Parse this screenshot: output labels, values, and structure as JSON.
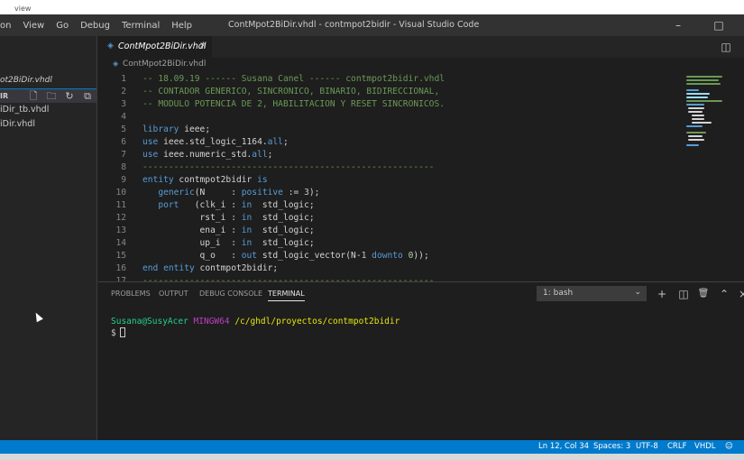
{
  "top_strip": {
    "label": "view"
  },
  "menu": [
    "on",
    "View",
    "Go",
    "Debug",
    "Terminal",
    "Help"
  ],
  "window_title": "ContMpot2BiDir.vhdl - contmpot2bidir - Visual Studio Code",
  "window_controls": {
    "minimize": "–",
    "maximize": "□"
  },
  "sidebar": {
    "project_label": "ot2BiDir.vhdl",
    "dir_label": "IR",
    "files": [
      "iDir_tb.vhdl",
      "iDir.vhdl"
    ]
  },
  "tab": {
    "label": "ContMpot2BiDir.vhdl",
    "close": "×"
  },
  "breadcrumb": {
    "label": "ContMpot2BiDir.vhdl"
  },
  "code_lines": [
    {
      "n": "1",
      "tokens": [
        [
          "cm",
          "-- 18.09.19 ------ Susana Canel ------ contmpot2bidir.vhdl"
        ]
      ]
    },
    {
      "n": "2",
      "tokens": [
        [
          "cm",
          "-- CONTADOR GENERICO, SINCRONICO, BINARIO, BIDIRECCIONAL,"
        ]
      ]
    },
    {
      "n": "3",
      "tokens": [
        [
          "cm",
          "-- MODULO POTENCIA DE 2, HABILITACION Y RESET SINCRONICOS."
        ]
      ]
    },
    {
      "n": "4",
      "tokens": []
    },
    {
      "n": "5",
      "tokens": [
        [
          "kw",
          "library"
        ],
        [
          "id",
          " ieee;"
        ]
      ]
    },
    {
      "n": "6",
      "tokens": [
        [
          "kw",
          "use"
        ],
        [
          "id",
          " ieee.std_logic_1164."
        ],
        [
          "kw",
          "all"
        ],
        [
          "id",
          ";"
        ]
      ]
    },
    {
      "n": "7",
      "tokens": [
        [
          "kw",
          "use"
        ],
        [
          "id",
          " ieee.numeric_std."
        ],
        [
          "kw",
          "all"
        ],
        [
          "id",
          ";"
        ]
      ]
    },
    {
      "n": "8",
      "tokens": [
        [
          "cm",
          "--------------------------------------------------------"
        ]
      ]
    },
    {
      "n": "9",
      "tokens": [
        [
          "kw",
          "entity"
        ],
        [
          "id",
          " contmpot2bidir "
        ],
        [
          "kw",
          "is"
        ]
      ]
    },
    {
      "n": "10",
      "tokens": [
        [
          "kw",
          "   generic"
        ],
        [
          "id",
          "(N     : "
        ],
        [
          "kw",
          "positive"
        ],
        [
          "id",
          " := "
        ],
        [
          "num",
          "3"
        ],
        [
          "id",
          ");"
        ]
      ]
    },
    {
      "n": "11",
      "tokens": [
        [
          "kw",
          "   port"
        ],
        [
          "id",
          "   (clk_i : "
        ],
        [
          "kw",
          "in"
        ],
        [
          "id",
          "  std_logic;"
        ]
      ]
    },
    {
      "n": "12",
      "tokens": [
        [
          "id",
          "           rst_i : "
        ],
        [
          "kw",
          "in"
        ],
        [
          "id",
          "  std_logic;"
        ]
      ]
    },
    {
      "n": "13",
      "tokens": [
        [
          "id",
          "           ena_i : "
        ],
        [
          "kw",
          "in"
        ],
        [
          "id",
          "  std_logic;"
        ]
      ]
    },
    {
      "n": "14",
      "tokens": [
        [
          "id",
          "           up_i  : "
        ],
        [
          "kw",
          "in"
        ],
        [
          "id",
          "  std_logic;"
        ]
      ]
    },
    {
      "n": "15",
      "tokens": [
        [
          "id",
          "           q_o   : "
        ],
        [
          "kw",
          "out"
        ],
        [
          "id",
          " std_logic_vector(N-"
        ],
        [
          "num",
          "1"
        ],
        [
          "kw",
          " downto "
        ],
        [
          "num",
          "0"
        ],
        [
          "id",
          "));"
        ]
      ]
    },
    {
      "n": "16",
      "tokens": [
        [
          "kw",
          "end entity"
        ],
        [
          "id",
          " contmpot2bidir;"
        ]
      ]
    },
    {
      "n": "17",
      "tokens": [
        [
          "cm",
          "--------------------------------------------------------"
        ]
      ]
    }
  ],
  "panel": {
    "tabs": [
      "PROBLEMS",
      "OUTPUT",
      "DEBUG CONSOLE",
      "TERMINAL"
    ],
    "active_tab": "TERMINAL",
    "terminal_select": "1: bash",
    "icons": {
      "add": "+",
      "split": "◫",
      "trash": "🗑",
      "maximize": "⌃",
      "close": "×"
    }
  },
  "terminal": {
    "user": "Susana@SusyAcer",
    "system": "MINGW64",
    "path": "/c/ghdl/proyectos/contmpot2bidir",
    "prompt": "$"
  },
  "status": {
    "position": "Ln 12, Col 34",
    "spaces": "Spaces: 3",
    "encoding": "UTF-8",
    "eol": "CRLF",
    "language": "VHDL",
    "feedback": "☺"
  },
  "colors": {
    "status_bg": "#007acc",
    "editor_bg": "#1e1e1e",
    "comment": "#6a9955",
    "keyword": "#569cd6"
  }
}
